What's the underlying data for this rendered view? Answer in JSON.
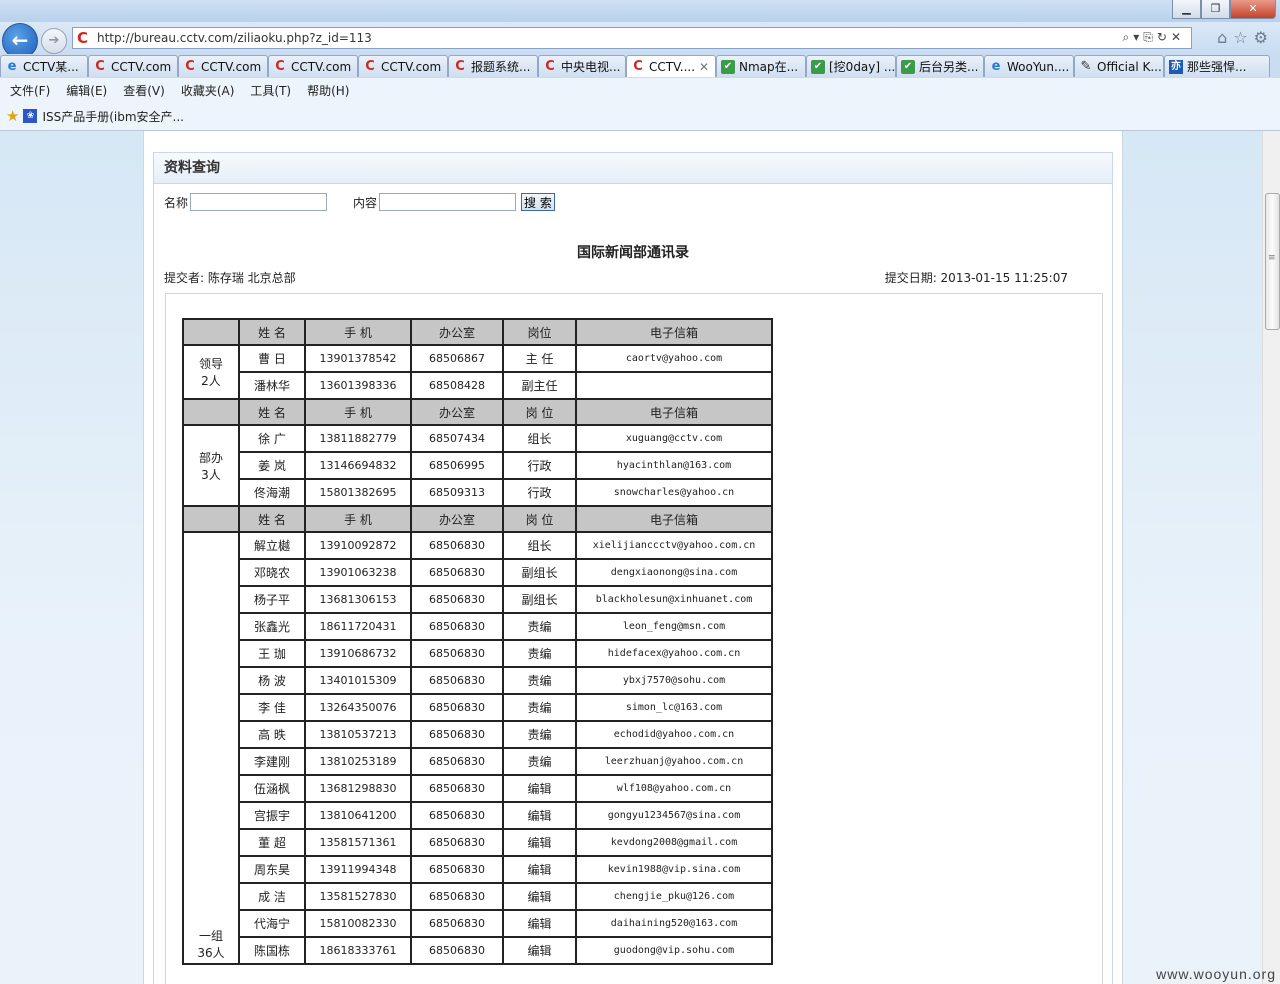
{
  "browser": {
    "url": "http://bureau.cctv.com/ziliaoku.php?z_id=113",
    "tabs": [
      {
        "label": "CCTV某...",
        "icon": "ie"
      },
      {
        "label": "CCTV.com",
        "icon": "c"
      },
      {
        "label": "CCTV.com",
        "icon": "c"
      },
      {
        "label": "CCTV.com",
        "icon": "c"
      },
      {
        "label": "CCTV.com",
        "icon": "c"
      },
      {
        "label": "报题系统...",
        "icon": "c"
      },
      {
        "label": "中央电视...",
        "icon": "c"
      },
      {
        "label": "CCTV....",
        "icon": "c",
        "active": true
      },
      {
        "label": "Nmap在...",
        "icon": "g"
      },
      {
        "label": "[挖0day] ...",
        "icon": "g"
      },
      {
        "label": "后台另类...",
        "icon": "g"
      },
      {
        "label": "WooYun....",
        "icon": "ie"
      },
      {
        "label": "Official K...",
        "icon": "k"
      },
      {
        "label": "那些强悍...",
        "icon": "b"
      }
    ],
    "menu": [
      "文件(F)",
      "编辑(E)",
      "查看(V)",
      "收藏夹(A)",
      "工具(T)",
      "帮助(H)"
    ],
    "favorite": "ISS产品手册(ibm安全产..."
  },
  "page": {
    "panel_title": "资料查询",
    "search_name_label": "名称",
    "search_content_label": "内容",
    "search_button": "搜 索",
    "doc_title": "国际新闻部通讯录",
    "submitter": "提交者: 陈存瑞 北京总部",
    "submit_date": "提交日期: 2013-01-15 11:25:07"
  },
  "directory": [
    {
      "group": "领导\n2人",
      "headers": [
        "姓 名",
        "手 机",
        "办公室",
        "岗位",
        "电子信箱"
      ],
      "rows": [
        [
          "曹 日",
          "13901378542",
          "68506867",
          "主 任",
          "caortv@yahoo.com"
        ],
        [
          "潘林华",
          "13601398336",
          "68508428",
          "副主任",
          ""
        ]
      ]
    },
    {
      "group": "部办\n3人",
      "headers": [
        "姓 名",
        "手 机",
        "办公室",
        "岗 位",
        "电子信箱"
      ],
      "rows": [
        [
          "徐 广",
          "13811882779",
          "68507434",
          "组长",
          "xuguang@cctv.com"
        ],
        [
          "姜 岚",
          "13146694832",
          "68506995",
          "行政",
          "hyacinthlan@163.com"
        ],
        [
          "佟海潮",
          "15801382695",
          "68509313",
          "行政",
          "snowcharles@yahoo.cn"
        ]
      ]
    },
    {
      "group": "一组\n36人",
      "headers": [
        "姓 名",
        "手 机",
        "办公室",
        "岗 位",
        "电子信箱"
      ],
      "rows": [
        [
          "解立樾",
          "13910092872",
          "68506830",
          "组长",
          "xielijianccctv@yahoo.com.cn"
        ],
        [
          "邓晓农",
          "13901063238",
          "68506830",
          "副组长",
          "dengxiaonong@sina.com"
        ],
        [
          "杨子平",
          "13681306153",
          "68506830",
          "副组长",
          "blackholesun@xinhuanet.com"
        ],
        [
          "张鑫光",
          "18611720431",
          "68506830",
          "责编",
          "leon_feng@msn.com"
        ],
        [
          "王 珈",
          "13910686732",
          "68506830",
          "责编",
          "hidefacex@yahoo.com.cn"
        ],
        [
          "杨 波",
          "13401015309",
          "68506830",
          "责编",
          "ybxj7570@sohu.com"
        ],
        [
          "李 佳",
          "13264350076",
          "68506830",
          "责编",
          "simon_lc@163.com"
        ],
        [
          "高 昳",
          "13810537213",
          "68506830",
          "责编",
          "echodid@yahoo.com.cn"
        ],
        [
          "李建刚",
          "13810253189",
          "68506830",
          "责编",
          "leerzhuanj@yahoo.com.cn"
        ],
        [
          "伍涵枫",
          "13681298830",
          "68506830",
          "编辑",
          "wlf108@yahoo.com.cn"
        ],
        [
          "宫振宇",
          "13810641200",
          "68506830",
          "编辑",
          "gongyu1234567@sina.com"
        ],
        [
          "董 超",
          "13581571361",
          "68506830",
          "编辑",
          "kevdong2008@gmail.com"
        ],
        [
          "周东昊",
          "13911994348",
          "68506830",
          "编辑",
          "kevin1988@vip.sina.com"
        ],
        [
          "成 洁",
          "13581527830",
          "68506830",
          "编辑",
          "chengjie_pku@126.com"
        ],
        [
          "代海宁",
          "15810082330",
          "68506830",
          "编辑",
          "daihaining520@163.com"
        ],
        [
          "陈国栋",
          "18618333761",
          "68506830",
          "编辑",
          "guodong@vip.sohu.com"
        ]
      ]
    }
  ],
  "watermark": "www.wooyun.org"
}
